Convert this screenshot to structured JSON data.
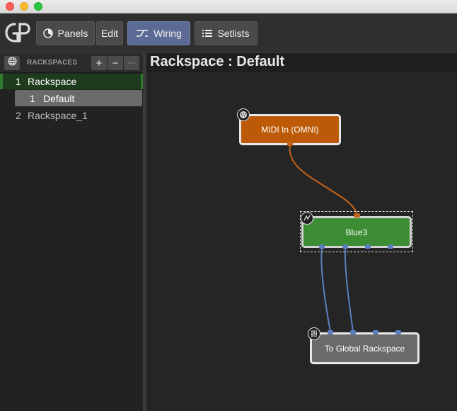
{
  "toolbar": {
    "panels_label": "Panels",
    "edit_label": "Edit",
    "wiring_label": "Wiring",
    "setlists_label": "Setlists",
    "active_tab": "Wiring"
  },
  "sidebar": {
    "header_title": "RACKSPACES",
    "add_label": "+",
    "remove_label": "−",
    "more_label": "···",
    "rackspaces": [
      {
        "number": "1",
        "name": "Rackspace",
        "selected": true,
        "variations": [
          {
            "number": "1",
            "name": "Default",
            "selected": true
          }
        ]
      },
      {
        "number": "2",
        "name": "Rackspace_1",
        "selected": false
      }
    ]
  },
  "main": {
    "title": "Rackspace : Default",
    "nodes": {
      "midi_in": {
        "label": "MIDI In (OMNI)",
        "color": "#bd5a08"
      },
      "blue3": {
        "label": "Blue3",
        "color": "#3c8c34"
      },
      "global": {
        "label": "To Global Rackspace",
        "color": "#6a6a6a"
      }
    },
    "wire_colors": {
      "midi": "#c4621a",
      "audio": "#5b7fc0"
    }
  }
}
